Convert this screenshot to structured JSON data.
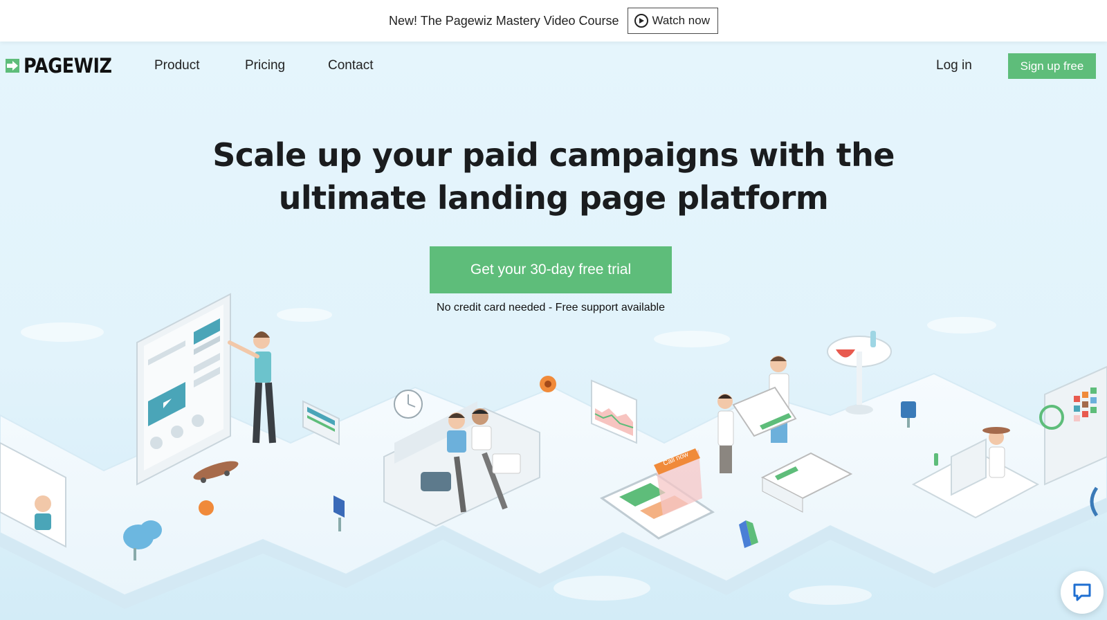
{
  "promo": {
    "text": "New! The Pagewiz Mastery Video Course",
    "watch_label": "Watch now"
  },
  "brand": {
    "name": "PAGEWIZ",
    "accent": "#5ebd7a"
  },
  "nav": {
    "items": [
      {
        "label": "Product"
      },
      {
        "label": "Pricing"
      },
      {
        "label": "Contact"
      }
    ],
    "login_label": "Log in",
    "signup_label": "Sign up free"
  },
  "hero": {
    "headline_line1": "Scale up your paid campaigns with the",
    "headline_line2": "ultimate landing page platform",
    "cta_label": "Get your 30-day free trial",
    "cta_subtext": "No credit card needed - Free support available"
  },
  "illustration": {
    "phone_badge": "Call now"
  },
  "chat": {
    "icon": "chat-bubble-icon"
  }
}
